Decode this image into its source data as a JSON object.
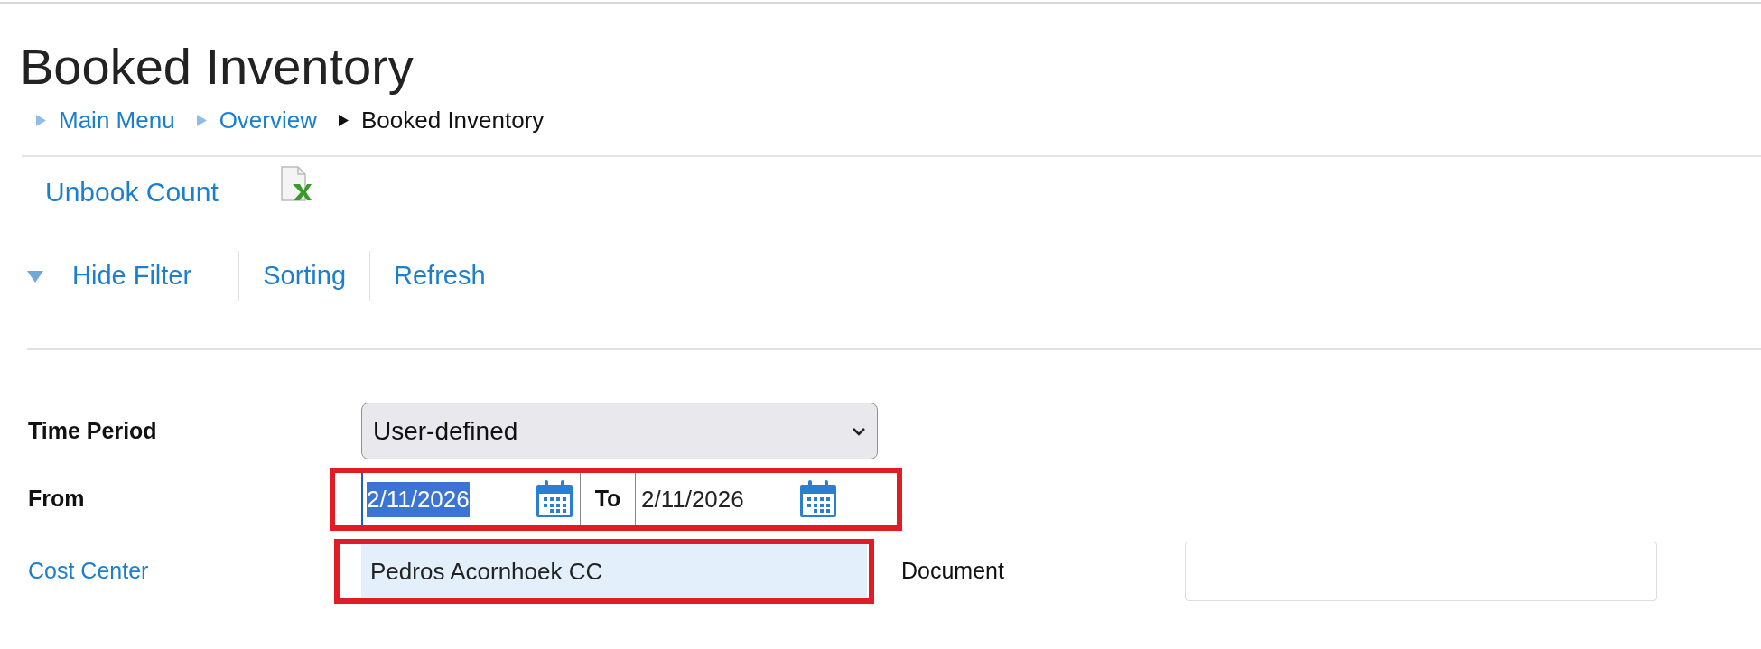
{
  "page": {
    "title": "Booked Inventory"
  },
  "breadcrumb": [
    {
      "label": "Main Menu",
      "current": false
    },
    {
      "label": "Overview",
      "current": false
    },
    {
      "label": "Booked Inventory",
      "current": true
    }
  ],
  "actions": [
    {
      "label": "Unbook Count"
    }
  ],
  "toolbar": [
    {
      "label": "Hide Filter",
      "kind": "toggle"
    },
    {
      "label": "Sorting",
      "kind": "link"
    },
    {
      "label": "Refresh",
      "kind": "link"
    }
  ],
  "filter": {
    "time_period": {
      "label": "Time Period",
      "value": "User-defined"
    },
    "from": {
      "label": "From",
      "value": "2/11/2026",
      "text_selected": true
    },
    "to": {
      "label": "To",
      "value": "2/11/2026",
      "text_selected": false
    },
    "date_range_highlighted": true,
    "cost_center": {
      "label": "Cost Center",
      "value": "Pedros Acornhoek CC",
      "highlighted": true
    },
    "document": {
      "label": "Document"
    }
  }
}
